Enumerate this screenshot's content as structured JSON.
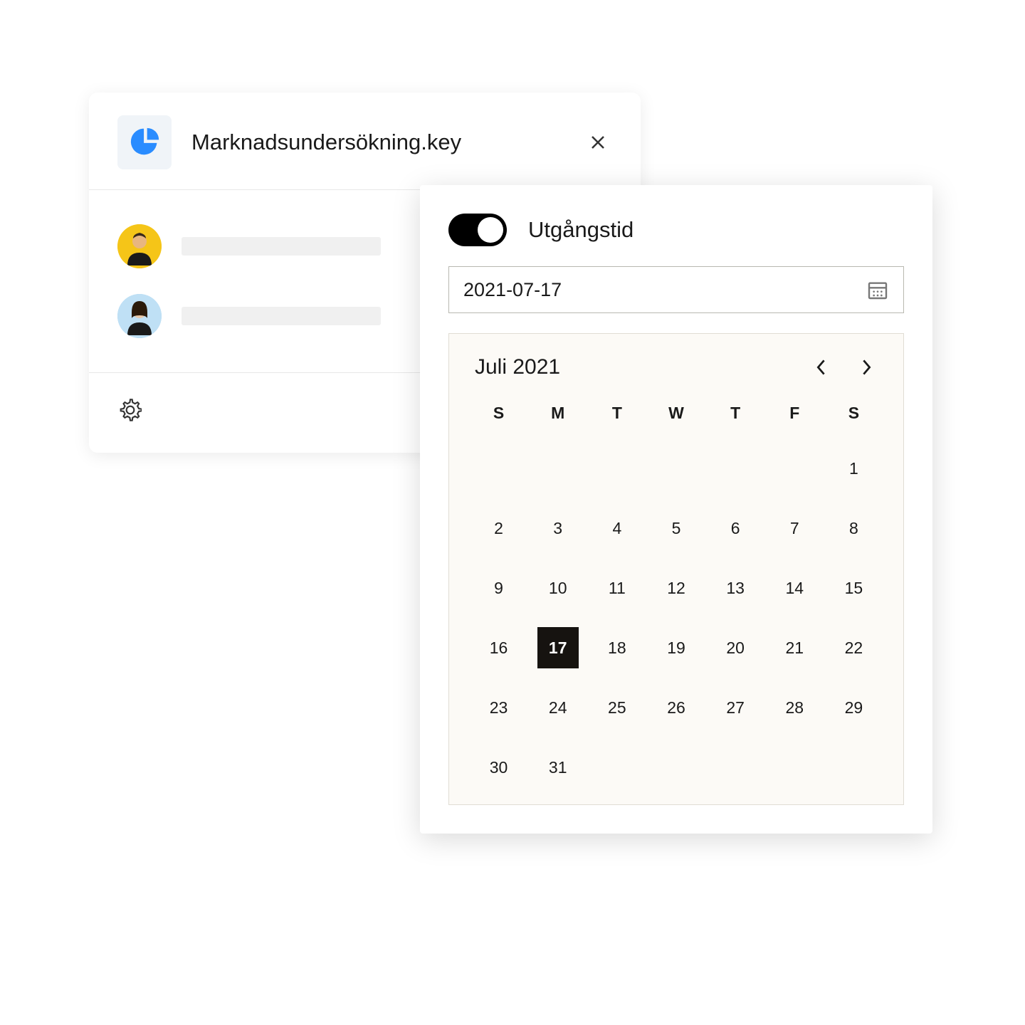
{
  "share": {
    "file_title": "Marknadsundersökning.key",
    "users": [
      {
        "avatar_bg": "#f5c518"
      },
      {
        "avatar_bg": "#a8d4f0"
      }
    ]
  },
  "expiry": {
    "label": "Utgångstid",
    "toggle_on": true,
    "date_value": "2021-07-17"
  },
  "calendar": {
    "month_label": "Juli 2021",
    "weekdays": [
      "S",
      "M",
      "T",
      "W",
      "T",
      "F",
      "S"
    ],
    "leading_empty": 6,
    "days_in_month": 31,
    "selected_day": 17
  }
}
